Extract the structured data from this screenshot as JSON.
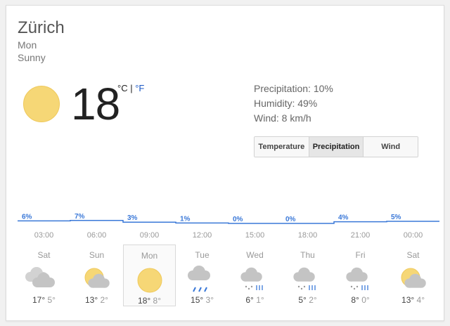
{
  "location": {
    "city": "Zürich",
    "day": "Mon",
    "condition": "Sunny"
  },
  "current": {
    "temperature": "18",
    "unit_c": "°C",
    "unit_sep": "|",
    "unit_f": "°F",
    "icon": "sun-icon"
  },
  "details": {
    "precipitation": "Precipitation: 10%",
    "humidity": "Humidity: 49%",
    "wind": "Wind: 8 km/h"
  },
  "tabs": [
    {
      "label": "Temperature",
      "active": false
    },
    {
      "label": "Precipitation",
      "active": true
    },
    {
      "label": "Wind",
      "active": false
    }
  ],
  "colors": {
    "accent": "#3a78d8",
    "sun": "#f6d776",
    "cloud": "#c4c4c4",
    "rain": "#3a78d8"
  },
  "chart_data": {
    "type": "line",
    "title": "",
    "x": [
      "03:00",
      "06:00",
      "09:00",
      "12:00",
      "15:00",
      "18:00",
      "21:00",
      "00:00"
    ],
    "values": [
      6,
      7,
      3,
      1,
      0,
      0,
      4,
      5
    ],
    "data_labels": [
      "6%",
      "7%",
      "3%",
      "1%",
      "0%",
      "0%",
      "4%",
      "5%"
    ],
    "xlabel": "",
    "ylabel": "",
    "grid": false
  },
  "forecast": [
    {
      "day": "Sat",
      "high": "17°",
      "low": "5°",
      "icon": "cloudy-icon"
    },
    {
      "day": "Sun",
      "high": "13°",
      "low": "2°",
      "icon": "partly-cloudy-icon"
    },
    {
      "day": "Mon",
      "high": "18°",
      "low": "8°",
      "icon": "sun-icon",
      "selected": true
    },
    {
      "day": "Tue",
      "high": "15°",
      "low": "3°",
      "icon": "rain-icon"
    },
    {
      "day": "Wed",
      "high": "6°",
      "low": "1°",
      "icon": "snow-rain-icon"
    },
    {
      "day": "Thu",
      "high": "5°",
      "low": "2°",
      "icon": "snow-rain-icon"
    },
    {
      "day": "Fri",
      "high": "8°",
      "low": "0°",
      "icon": "snow-rain-icon"
    },
    {
      "day": "Sat",
      "high": "13°",
      "low": "4°",
      "icon": "partly-cloudy-icon"
    }
  ]
}
